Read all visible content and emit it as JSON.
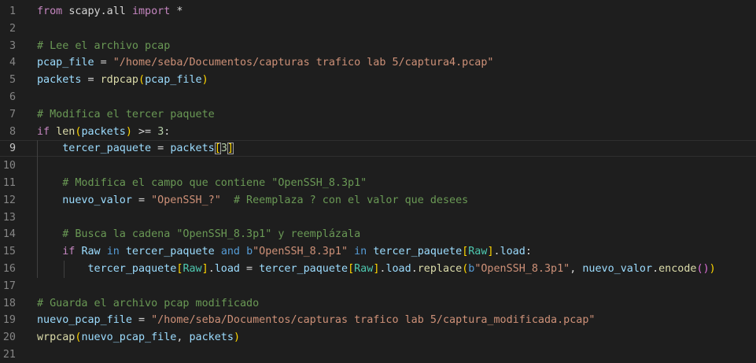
{
  "lines": [
    {
      "n": "1",
      "tokens": [
        [
          "k",
          "from"
        ],
        [
          "o",
          " "
        ],
        [
          "o",
          "scapy.all "
        ],
        [
          "k",
          "import"
        ],
        [
          "o",
          " *"
        ]
      ]
    },
    {
      "n": "2",
      "tokens": []
    },
    {
      "n": "3",
      "tokens": [
        [
          "c",
          "# Lee el archivo pcap"
        ]
      ]
    },
    {
      "n": "4",
      "tokens": [
        [
          "v",
          "pcap_file"
        ],
        [
          "o",
          " = "
        ],
        [
          "s",
          "\"/home/seba/Documentos/capturas trafico lab 5/captura4.pcap\""
        ]
      ]
    },
    {
      "n": "5",
      "tokens": [
        [
          "v",
          "packets"
        ],
        [
          "o",
          " = "
        ],
        [
          "f",
          "rdpcap"
        ],
        [
          "c1",
          "("
        ],
        [
          "v",
          "pcap_file"
        ],
        [
          "c1",
          ")"
        ]
      ]
    },
    {
      "n": "6",
      "tokens": []
    },
    {
      "n": "7",
      "tokens": [
        [
          "c",
          "# Modifica el tercer paquete"
        ]
      ]
    },
    {
      "n": "8",
      "tokens": [
        [
          "k",
          "if"
        ],
        [
          "o",
          " "
        ],
        [
          "f",
          "len"
        ],
        [
          "c1",
          "("
        ],
        [
          "v",
          "packets"
        ],
        [
          "c1",
          ")"
        ],
        [
          "o",
          " >= "
        ],
        [
          "n",
          "3"
        ],
        [
          "o",
          ":"
        ]
      ]
    },
    {
      "n": "9",
      "tokens": [
        [
          "o",
          "    "
        ],
        [
          "v",
          "tercer_paquete"
        ],
        [
          "o",
          " = "
        ],
        [
          "v",
          "packets"
        ],
        [
          "c1b",
          "["
        ],
        [
          "n",
          "3"
        ],
        [
          "c1",
          ""
        ]
      ]
    },
    {
      "n": "10",
      "tokens": []
    },
    {
      "n": "11",
      "tokens": [
        [
          "o",
          "    "
        ],
        [
          "c",
          "# Modifica el campo que contiene \"OpenSSH_8.3p1\""
        ]
      ]
    },
    {
      "n": "12",
      "tokens": [
        [
          "o",
          "    "
        ],
        [
          "v",
          "nuevo_valor"
        ],
        [
          "o",
          " = "
        ],
        [
          "s",
          "\"OpenSSH_?\""
        ],
        [
          "o",
          "  "
        ],
        [
          "c",
          "# Reemplaza ? con el valor que desees"
        ]
      ]
    },
    {
      "n": "13",
      "tokens": []
    },
    {
      "n": "14",
      "tokens": [
        [
          "o",
          "    "
        ],
        [
          "c",
          "# Busca la cadena \"OpenSSH_8.3p1\" y reemplázala"
        ]
      ]
    },
    {
      "n": "15",
      "tokens": [
        [
          "o",
          "    "
        ],
        [
          "k",
          "if"
        ],
        [
          "o",
          " "
        ],
        [
          "v",
          "Raw"
        ],
        [
          "o",
          " "
        ],
        [
          "kb",
          "in"
        ],
        [
          "o",
          " "
        ],
        [
          "v",
          "tercer_paquete"
        ],
        [
          "o",
          " "
        ],
        [
          "kb",
          "and"
        ],
        [
          "o",
          " "
        ],
        [
          "kb",
          "b"
        ],
        [
          "s",
          "\"OpenSSH_8.3p1\""
        ],
        [
          "o",
          " "
        ],
        [
          "kb",
          "in"
        ],
        [
          "o",
          " "
        ],
        [
          "v",
          "tercer_paquete"
        ],
        [
          "c1",
          "["
        ],
        [
          "cls",
          "Raw"
        ],
        [
          "c1",
          "]"
        ],
        [
          "o",
          "."
        ],
        [
          "v",
          "load"
        ],
        [
          "o",
          ":"
        ]
      ]
    },
    {
      "n": "16",
      "tokens": [
        [
          "o",
          "        "
        ],
        [
          "v",
          "tercer_paquete"
        ],
        [
          "c1",
          "["
        ],
        [
          "cls",
          "Raw"
        ],
        [
          "c1",
          "]"
        ],
        [
          "o",
          "."
        ],
        [
          "v",
          "load"
        ],
        [
          "o",
          " = "
        ],
        [
          "v",
          "tercer_paquete"
        ],
        [
          "c1",
          "["
        ],
        [
          "cls",
          "Raw"
        ],
        [
          "c1",
          "]"
        ],
        [
          "o",
          "."
        ],
        [
          "v",
          "load"
        ],
        [
          "o",
          "."
        ],
        [
          "f",
          "replace"
        ],
        [
          "c1",
          "("
        ],
        [
          "kb",
          "b"
        ],
        [
          "s",
          "\"OpenSSH_8.3p1\""
        ],
        [
          "o",
          ", "
        ],
        [
          "v",
          "nuevo_valor"
        ],
        [
          "o",
          "."
        ],
        [
          "f",
          "encode"
        ],
        [
          "c2",
          "("
        ],
        [
          "c2",
          ")"
        ],
        [
          "c1",
          ")"
        ]
      ]
    },
    {
      "n": "17",
      "tokens": []
    },
    {
      "n": "18",
      "tokens": [
        [
          "c",
          "# Guarda el archivo pcap modificado"
        ]
      ]
    },
    {
      "n": "19",
      "tokens": [
        [
          "v",
          "nuevo_pcap_file"
        ],
        [
          "o",
          " = "
        ],
        [
          "s",
          "\"/home/seba/Documentos/capturas trafico lab 5/captura_modificada.pcap\""
        ]
      ]
    },
    {
      "n": "20",
      "tokens": [
        [
          "f",
          "wrpcap"
        ],
        [
          "c1",
          "("
        ],
        [
          "v",
          "nuevo_pcap_file"
        ],
        [
          "o",
          ", "
        ],
        [
          "v",
          "packets"
        ],
        [
          "c1",
          ")"
        ]
      ]
    },
    {
      "n": "21",
      "tokens": []
    }
  ],
  "current_line": "9"
}
